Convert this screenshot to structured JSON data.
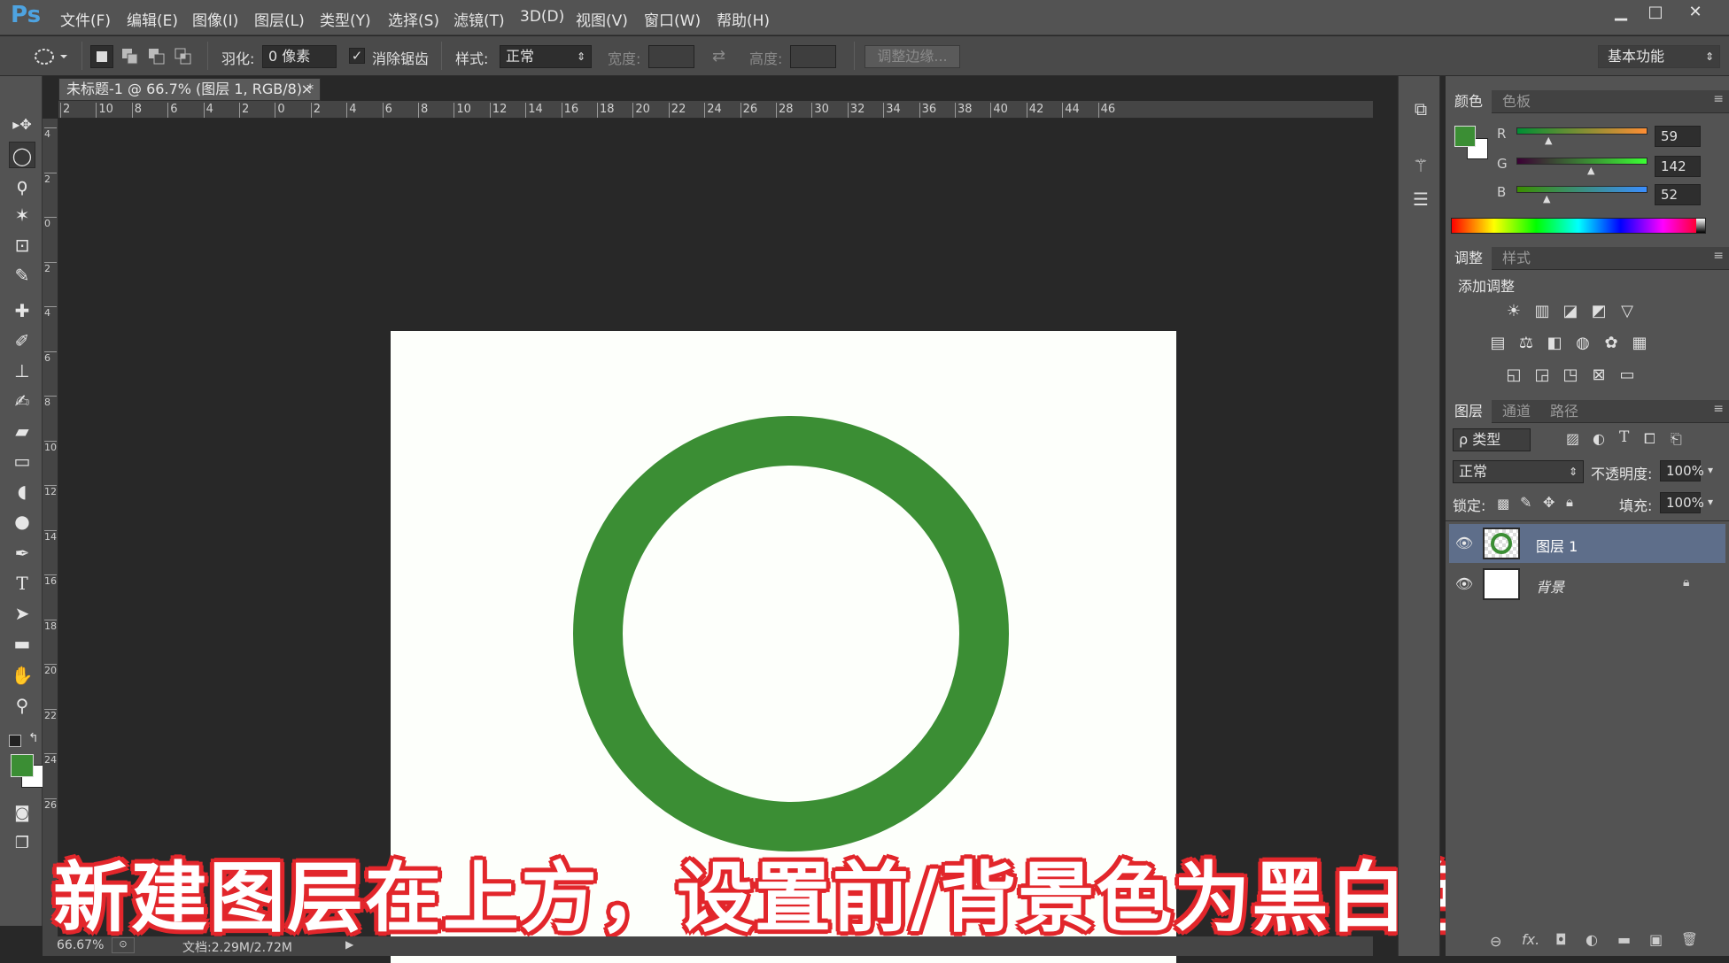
{
  "app": {
    "logo": "Ps"
  },
  "menu": [
    "文件(F)",
    "编辑(E)",
    "图像(I)",
    "图层(L)",
    "类型(Y)",
    "选择(S)",
    "滤镜(T)",
    "3D(D)",
    "视图(V)",
    "窗口(W)",
    "帮助(H)"
  ],
  "window_controls": {
    "minimize": "▁",
    "maximize": "□",
    "close": "✕"
  },
  "options": {
    "feather_label": "羽化:",
    "feather_value": "0 像素",
    "antialias_label": "消除锯齿",
    "style_label": "样式:",
    "style_value": "正常",
    "width_label": "宽度:",
    "height_label": "高度:",
    "refine_edge": "调整边缘...",
    "workspace": "基本功能"
  },
  "document": {
    "tab_title": "未标题-1 @ 66.7% (图层 1, RGB/8) *",
    "close": "×",
    "zoom": "66.67%",
    "doc_size": "文档:2.29M/2.72M"
  },
  "ruler_h_ticks": [
    "2",
    "10",
    "8",
    "6",
    "4",
    "2",
    "0",
    "2",
    "4",
    "6",
    "8",
    "10",
    "12",
    "14",
    "16",
    "18",
    "20",
    "22",
    "24",
    "26",
    "28",
    "30",
    "32",
    "34",
    "36",
    "38",
    "40",
    "42",
    "44",
    "46"
  ],
  "ruler_v_ticks": [
    "4",
    "2",
    "0",
    "2",
    "4",
    "6",
    "8",
    "10",
    "12",
    "14",
    "16",
    "18",
    "20",
    "22",
    "24",
    "26"
  ],
  "canvas": {
    "background": "#fdfffb",
    "ring_color": "#3b8e34"
  },
  "caption": "新建图层在上方，设置前/背景色为黑白色",
  "color_panel": {
    "tabs": [
      "颜色",
      "色板"
    ],
    "foreground": "#3b8e34",
    "background": "#ffffff",
    "r_label": "R",
    "r_value": "59",
    "g_label": "G",
    "g_value": "142",
    "b_label": "B",
    "b_value": "52"
  },
  "adjust_panel": {
    "tabs": [
      "调整",
      "样式"
    ],
    "heading": "添加调整",
    "icons_row1": [
      "☀",
      "▥",
      "◪",
      "◩",
      "▽"
    ],
    "icons_row2": [
      "▤",
      "⚖",
      "◧",
      "◍",
      "✿",
      "▦"
    ],
    "icons_row3": [
      "◱",
      "◲",
      "◳",
      "⊠",
      "▭"
    ]
  },
  "layers_panel": {
    "tabs": [
      "图层",
      "通道",
      "路径"
    ],
    "filter_label": "ρ 类型",
    "blend_mode": "正常",
    "opacity_label": "不透明度:",
    "opacity_value": "100%",
    "lock_label": "锁定:",
    "fill_label": "填充:",
    "fill_value": "100%",
    "layers": [
      {
        "name": "图层 1",
        "selected": true
      },
      {
        "name": "背景",
        "selected": false,
        "locked": true
      }
    ],
    "footer_icons": [
      "⊖",
      "fx.",
      "◘",
      "◐",
      "▬",
      "▣",
      "🗑"
    ]
  }
}
